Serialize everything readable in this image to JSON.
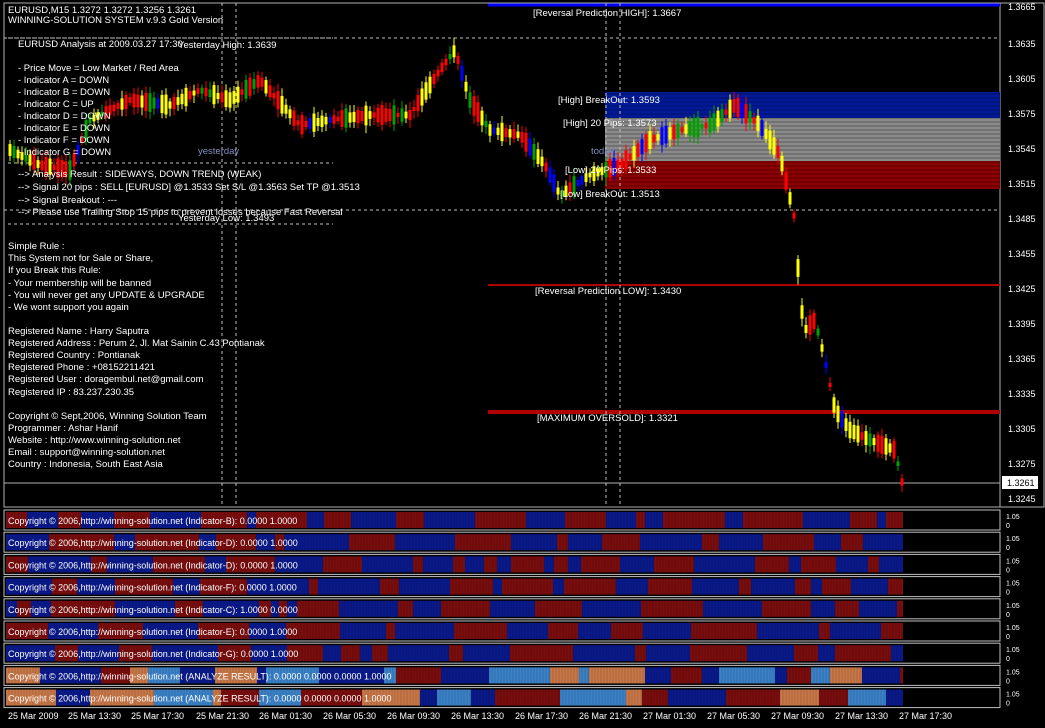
{
  "header": {
    "symbol_line": "EURUSD,M15  1.3272 1.3272 1.3256 1.3261",
    "system_line": "WINNING-SOLUTION SYSTEM v.9.3 Gold Version"
  },
  "analysis": {
    "title": "EURUSD Analysis at 2009.03.27 17:30",
    "lines": [
      "- Price Move = Low Market / Red Area",
      "- Indicator A = DOWN",
      "- Indicator B = DOWN",
      "- Indicator C = UP",
      "- Indicator D = DOWN",
      "- Indicator E = DOWN",
      "- Indicator F = DOWN",
      "- Indicator G = DOWN"
    ],
    "results": [
      "--> Analysis Result : SIDEWAYS, DOWN TREND (WEAK)",
      "--> Signal 20 pips : SELL [EURUSD] @1.3533 Set S/L @1.3563 Set TP @1.3513",
      "--> Signal Breakout : ---",
      "--> Please use Trailing Stop 15 pips to prevent losses because Fast Reversal"
    ]
  },
  "rules": {
    "lines": [
      "Simple Rule :",
      "This System not for Sale or Share,",
      "If you Break this Rule:",
      "- Your membership will be banned",
      "- You will never get any UPDATE & UPGRADE",
      "- We wont support you again"
    ]
  },
  "registration": {
    "lines": [
      "Registered Name : Harry Saputra",
      "Registered Address : Perum 2, Jl. Mat Sainin C.43 Pontianak",
      "Registered Country : Pontianak",
      "Registered Phone : +08152211421",
      "Registered User : doragembul.net@gmail.com",
      "Registered IP :  83.237.230.35"
    ]
  },
  "copyright": {
    "lines": [
      "Copyright © Sept,2006, Winning Solution Team",
      "Programmer : Ashar Hanif",
      "Website : http://www.winning-solution.net",
      "Email : support@winning-solution.net",
      "Country : Indonesia, South East Asia"
    ]
  },
  "labels": {
    "yesterday_high": "Yesterday High: 1.3639",
    "yesterday_low": "Yesterday Low: 1.3493",
    "yesterday": "yesterday",
    "today": "today",
    "reversal_high": "[Reversal Prediction HIGH]: 1.3667",
    "high_breakout": "[High] BreakOut: 1.3593",
    "high_20": "[High] 20 Pips: 1.3573",
    "low_20": "[Low] 20 Pips: 1.3533",
    "low_breakout": "[Low] BreakOut: 1.3513",
    "reversal_low": "[Reversal Prediction LOW]: 1.3430",
    "max_oversold": "[MAXIMUM OVERSOLD]: 1.3321",
    "current_price": "1.3261"
  },
  "price_axis": [
    "1.3665",
    "1.3635",
    "1.3605",
    "1.3575",
    "1.3545",
    "1.3515",
    "1.3485",
    "1.3455",
    "1.3425",
    "1.3395",
    "1.3365",
    "1.3335",
    "1.3305",
    "1.3275",
    "1.3245"
  ],
  "time_axis": [
    "25 Mar 2009",
    "25 Mar 13:30",
    "25 Mar 17:30",
    "25 Mar 21:30",
    "26 Mar 01:30",
    "26 Mar 05:30",
    "26 Mar 09:30",
    "26 Mar 13:30",
    "26 Mar 17:30",
    "26 Mar 21:30",
    "27 Mar 01:30",
    "27 Mar 05:30",
    "27 Mar 09:30",
    "27 Mar 13:30",
    "27 Mar 17:30"
  ],
  "indicator_panels": [
    {
      "label": "Copyright © 2006,http://winning-solution.net (Indicator-B): 0.0000 1.0000",
      "scale": [
        "1.05",
        "0"
      ]
    },
    {
      "label": "Copyright © 2006,http://winning-solution.net (Indicator-D): 0.0000 1.0000",
      "scale": [
        "1.05",
        "0"
      ]
    },
    {
      "label": "Copyright © 2006,http://winning-solution.net (Indicator-D): 0.0000 1.0000",
      "scale": [
        "1.05",
        "0"
      ]
    },
    {
      "label": "Copyright © 2006,http://winning-solution.net (Indicator-F): 0.0000 1.0000",
      "scale": [
        "1.05",
        "0"
      ]
    },
    {
      "label": "Copyright © 2006,http://winning-solution.net (Indicator-C): 1.0000 0.0000",
      "scale": [
        "1.05",
        "0"
      ]
    },
    {
      "label": "Copyright © 2006,http://winning-solution.net (Indicator-E): 0.0000 1.0000",
      "scale": [
        "1.05",
        "0"
      ]
    },
    {
      "label": "Copyright © 2006,http://winning-solution.net (Indicator-G): 0.0000 1.0000",
      "scale": [
        "1.05",
        "0"
      ]
    },
    {
      "label": "Copyright © 2006,http://winning-solution.net (ANALYZE RESULT): 0.0000 0.0000 0.0000 1.0000",
      "scale": [
        "1.05",
        "0"
      ]
    },
    {
      "label": "Copyright © 2006,http://winning-solution.net (ANALYZE RESULT): 0.0000 0.0000 0.0000 1.0000",
      "scale": [
        "1.05",
        "0"
      ]
    }
  ],
  "colors": {
    "background": "#000000",
    "bull_candle": "#ffff00",
    "bear_candle": "#ff0000",
    "blue_candle": "#0000ff",
    "green_candle": "#00a000",
    "zone_blue": "#001a99",
    "zone_gray": "#8a8a8a",
    "zone_red": "#8b0000",
    "bar_blue": "#0a1a8a",
    "bar_red": "#7a0d0d",
    "bar_orange": "#c87848",
    "bar_light_blue": "#3a82c8",
    "grid_line": "#c0c0c0",
    "separator": "#b0b0b0"
  }
}
